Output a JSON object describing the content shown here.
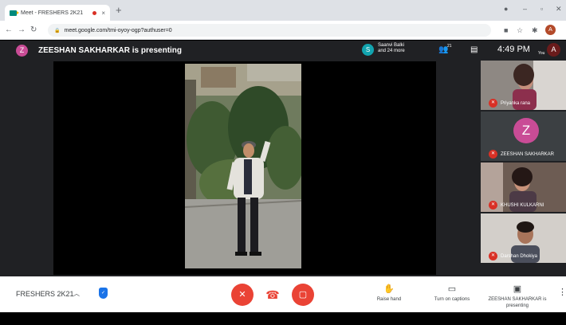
{
  "browser": {
    "tab_title": "Meet - FRESHERS 2K21",
    "tab_close": "×",
    "new_tab": "+",
    "url": "meet.google.com/tmi-oyoy-ogp?authuser=0",
    "profile_initial": "A"
  },
  "header": {
    "presenter_initial": "Z",
    "presenting_text": "ZEESHAN SAKHARKAR is presenting",
    "participant_initial": "S",
    "participants_line1": "Saanvi Balki",
    "participants_line2": "and 24 more",
    "people_count": "21",
    "time": "4:49 PM",
    "you_label": "You",
    "user_initial": "A"
  },
  "tiles": [
    {
      "name": "Priyanka rana"
    },
    {
      "name": "ZEESHAN SAKHARKAR",
      "initial": "Z"
    },
    {
      "name": "KHUSHI KULKARNI"
    },
    {
      "name": "Darshan Dhokiya"
    }
  ],
  "bottom": {
    "meeting_title": "FRESHERS 2K21",
    "actions": [
      {
        "label": "Raise hand"
      },
      {
        "label": "Turn on captions"
      },
      {
        "label": "ZEESHAN SAKHARKAR is presenting"
      }
    ]
  },
  "colors": {
    "meet_dark": "#202124",
    "mute_red": "#ea4335",
    "presenter_avatar": "#c94c96",
    "tile_avatar": "#c94c96",
    "shield_blue": "#1a73e8"
  }
}
